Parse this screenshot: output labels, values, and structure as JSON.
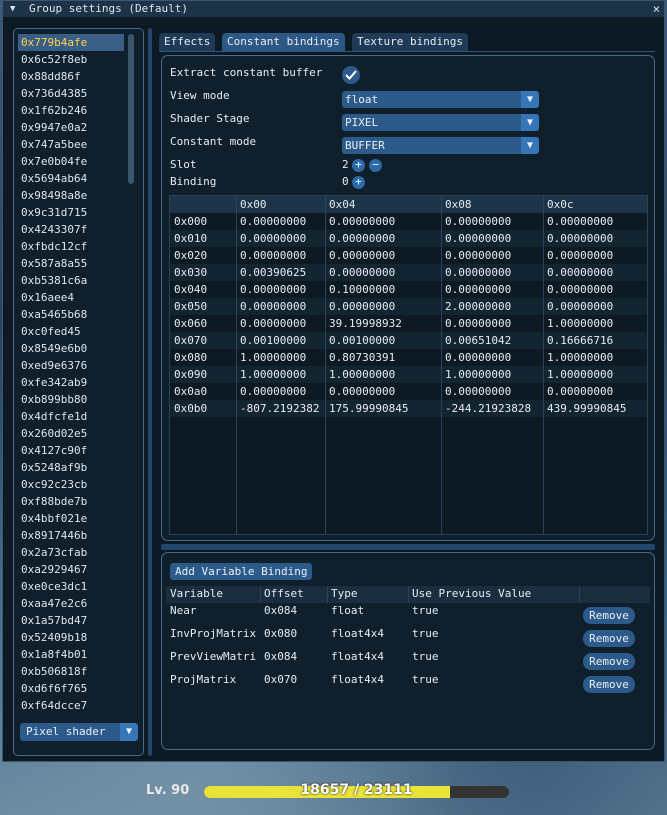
{
  "window": {
    "title": "Group settings (Default)",
    "close_glyph": "×",
    "collapse_glyph": "▼"
  },
  "left": {
    "items": [
      "0x779b4afe",
      "0x6c52f8eb",
      "0x88dd86f",
      "0x736d4385",
      "0x1f62b246",
      "0x9947e0a2",
      "0x747a5bee",
      "0x7e0b04fe",
      "0x5694ab64",
      "0x98498a8e",
      "0x9c31d715",
      "0x4243307f",
      "0xfbdc12cf",
      "0x587a8a55",
      "0xb5381c6a",
      "0x16aee4",
      "0xa5465b68",
      "0xc0fed45",
      "0x8549e6b0",
      "0xed9e6376",
      "0xfe342ab9",
      "0xb899bb80",
      "0x4dfcfe1d",
      "0x260d02e5",
      "0x4127c90f",
      "0x5248af9b",
      "0xc92c23cb",
      "0xf88bde7b",
      "0x4bbf021e",
      "0x8917446b",
      "0x2a73cfab",
      "0xa2929467",
      "0xe0ce3dc1",
      "0xaa47e2c6",
      "0x1a57bd47",
      "0x52409b18",
      "0x1a8f4b01",
      "0xb506818f",
      "0xd6f6f765",
      "0xf64dcce7"
    ],
    "selected_index": 0,
    "shader_select": "Pixel shader",
    "dropdown_glyph": "▼"
  },
  "tabs": [
    "Effects",
    "Constant bindings",
    "Texture bindings"
  ],
  "active_tab": 1,
  "props": {
    "extract_label": "Extract constant buffer",
    "extract_checked": true,
    "view_mode_label": "View mode",
    "view_mode_value": "float",
    "shader_stage_label": "Shader Stage",
    "shader_stage_value": "PIXEL",
    "constant_mode_label": "Constant mode",
    "constant_mode_value": "BUFFER",
    "slot_label": "Slot",
    "slot_value": "2",
    "binding_label": "Binding",
    "binding_value": "0",
    "plus_glyph": "+",
    "minus_glyph": "−"
  },
  "table": {
    "headers": [
      "",
      "0x00",
      "0x04",
      "0x08",
      "0x0c"
    ],
    "rows": [
      [
        "0x000",
        "0.00000000",
        "0.00000000",
        "0.00000000",
        "0.00000000"
      ],
      [
        "0x010",
        "0.00000000",
        "0.00000000",
        "0.00000000",
        "0.00000000"
      ],
      [
        "0x020",
        "0.00000000",
        "0.00000000",
        "0.00000000",
        "0.00000000"
      ],
      [
        "0x030",
        "0.00390625",
        "0.00000000",
        "0.00000000",
        "0.00000000"
      ],
      [
        "0x040",
        "0.00000000",
        "0.10000000",
        "0.00000000",
        "0.00000000"
      ],
      [
        "0x050",
        "0.00000000",
        "0.00000000",
        "2.00000000",
        "0.00000000"
      ],
      [
        "0x060",
        "0.00000000",
        "39.19998932",
        "0.00000000",
        "1.00000000"
      ],
      [
        "0x070",
        "0.00100000",
        "0.00100000",
        "0.00651042",
        "0.16666716"
      ],
      [
        "0x080",
        "1.00000000",
        "0.80730391",
        "0.00000000",
        "1.00000000"
      ],
      [
        "0x090",
        "1.00000000",
        "1.00000000",
        "1.00000000",
        "1.00000000"
      ],
      [
        "0x0a0",
        "0.00000000",
        "0.00000000",
        "0.00000000",
        "0.00000000"
      ],
      [
        "0x0b0",
        "-807.2192382",
        "175.99990845",
        "-244.21923828",
        "439.99990845"
      ]
    ]
  },
  "bindings": {
    "add_label": "Add Variable Binding",
    "headers": [
      "Variable",
      "Offset",
      "Type",
      "Use Previous Value"
    ],
    "rows": [
      {
        "variable": "Near",
        "offset": "0x084",
        "type": "float",
        "use_prev": "true"
      },
      {
        "variable": "InvProjMatrix",
        "offset": "0x080",
        "type": "float4x4",
        "use_prev": "true"
      },
      {
        "variable": "PrevViewMatri",
        "offset": "0x084",
        "type": "float4x4",
        "use_prev": "true"
      },
      {
        "variable": "ProjMatrix",
        "offset": "0x070",
        "type": "float4x4",
        "use_prev": "true"
      }
    ],
    "remove_label": "Remove"
  },
  "hud": {
    "level": "Lv. 90",
    "xp_text": "18657 / 23111",
    "xp_fraction": 0.807,
    "xp_color": "#e8e23a"
  }
}
